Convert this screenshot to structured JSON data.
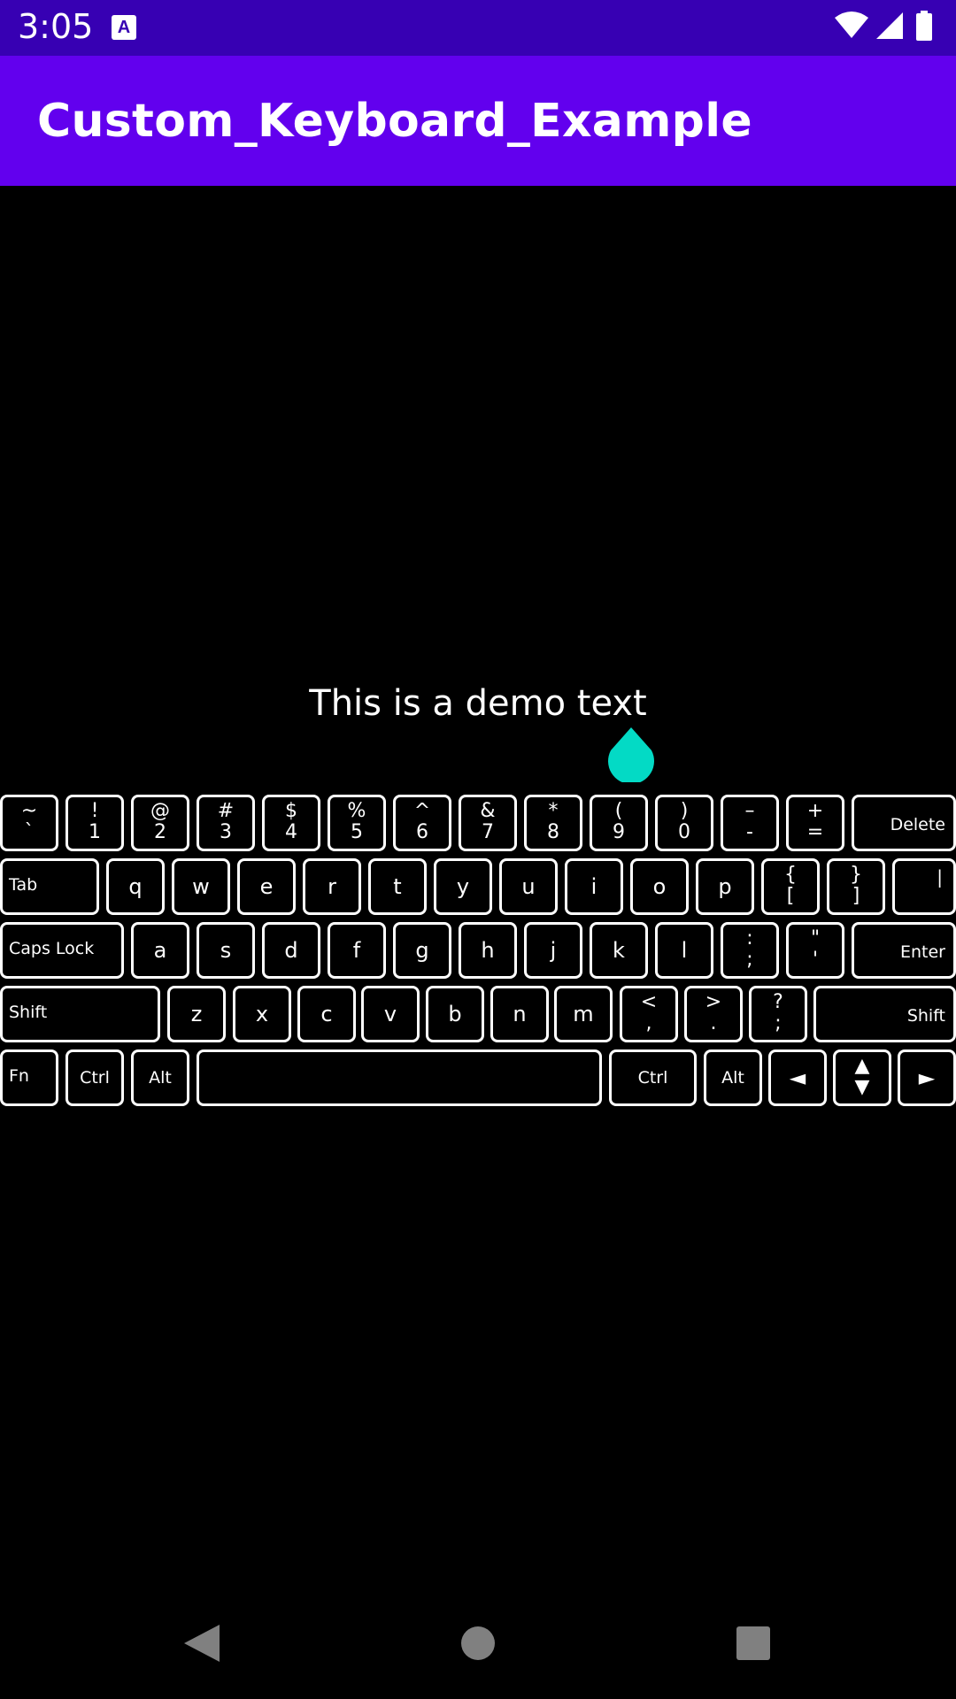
{
  "status": {
    "time": "3:05",
    "notification_icon": "A",
    "icons": [
      "wifi-icon",
      "cell-signal-icon",
      "battery-icon"
    ]
  },
  "appbar": {
    "title": "Custom_Keyboard_Example"
  },
  "content": {
    "demo_text": "This is a demo text"
  },
  "colors": {
    "statusbar": "#3700b3",
    "appbar": "#6200ee",
    "cursor_handle": "#03dac5"
  },
  "keyboard": {
    "row1": [
      {
        "top": "~",
        "bottom": "`"
      },
      {
        "top": "!",
        "bottom": "1"
      },
      {
        "top": "@",
        "bottom": "2"
      },
      {
        "top": "#",
        "bottom": "3"
      },
      {
        "top": "$",
        "bottom": "4"
      },
      {
        "top": "%",
        "bottom": "5"
      },
      {
        "top": "^",
        "bottom": "6"
      },
      {
        "top": "&",
        "bottom": "7"
      },
      {
        "top": "*",
        "bottom": "8"
      },
      {
        "top": "(",
        "bottom": "9"
      },
      {
        "top": ")",
        "bottom": "0"
      },
      {
        "top": "–",
        "bottom": "-"
      },
      {
        "top": "+",
        "bottom": "="
      },
      {
        "label": "Delete"
      }
    ],
    "row2": [
      {
        "label": "Tab"
      },
      {
        "label": "q"
      },
      {
        "label": "w"
      },
      {
        "label": "e"
      },
      {
        "label": "r"
      },
      {
        "label": "t"
      },
      {
        "label": "y"
      },
      {
        "label": "u"
      },
      {
        "label": "i"
      },
      {
        "label": "o"
      },
      {
        "label": "p"
      },
      {
        "top": "{",
        "bottom": "["
      },
      {
        "top": "}",
        "bottom": "]"
      },
      {
        "label": "|"
      }
    ],
    "row3": [
      {
        "label": "Caps Lock"
      },
      {
        "label": "a"
      },
      {
        "label": "s"
      },
      {
        "label": "d"
      },
      {
        "label": "f"
      },
      {
        "label": "g"
      },
      {
        "label": "h"
      },
      {
        "label": "j"
      },
      {
        "label": "k"
      },
      {
        "label": "l"
      },
      {
        "top": ":",
        "bottom": ";"
      },
      {
        "top": "\"",
        "bottom": "'"
      },
      {
        "label": "Enter"
      }
    ],
    "row4": [
      {
        "label": "Shift"
      },
      {
        "label": "z"
      },
      {
        "label": "x"
      },
      {
        "label": "c"
      },
      {
        "label": "v"
      },
      {
        "label": "b"
      },
      {
        "label": "n"
      },
      {
        "label": "m"
      },
      {
        "top": "<",
        "bottom": ","
      },
      {
        "top": ">",
        "bottom": "."
      },
      {
        "top": "?",
        "bottom": ";"
      },
      {
        "label": "Shift"
      }
    ],
    "row5": [
      {
        "label": "Fn"
      },
      {
        "label": "Ctrl"
      },
      {
        "label": "Alt"
      },
      {
        "label": ""
      },
      {
        "label": "Ctrl"
      },
      {
        "label": "Alt"
      },
      {
        "label": "◄"
      },
      {
        "top": "▲",
        "bottom": "▼"
      },
      {
        "label": "►"
      }
    ]
  },
  "navbar": {
    "buttons": [
      "back-icon",
      "home-icon",
      "recents-icon"
    ]
  }
}
